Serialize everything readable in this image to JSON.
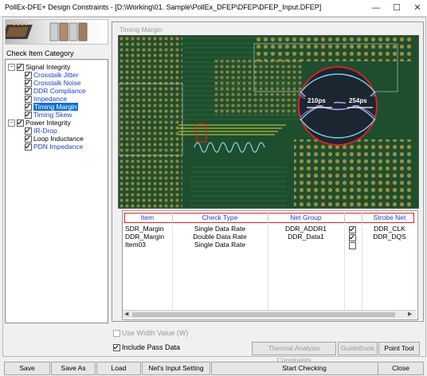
{
  "window": {
    "title": "PollEx-DFE+ Design Constraints - [D:\\Working\\01. Sample\\PollEx_DFEP\\DFEP\\DFEP_Input.DFEP]",
    "min": "—",
    "max": "☐",
    "close": "✕"
  },
  "sidebar": {
    "heading": "Check Item Category",
    "groups": [
      {
        "label": "Signal Integrity",
        "items": [
          "Crosstalk Jitter",
          "Crosstalk Noise",
          "DDR Compliance",
          "Impedance",
          "Timing Margin",
          "Timing Skew"
        ]
      },
      {
        "label": "Power Integrity",
        "items": [
          "IR-Drop",
          "Loop Inductance",
          "PDN Impedance"
        ]
      }
    ],
    "selected": "Timing Margin"
  },
  "panel": {
    "title": "Timing Margin",
    "eye_left": "210ps",
    "eye_right": "254ps"
  },
  "table": {
    "headers": [
      "Item",
      "Check Type",
      "Net Group",
      "",
      "Strobe Net"
    ],
    "rows": [
      {
        "item": "SDR_Margin",
        "check_type": "Single Data Rate",
        "net_group": "DDR_ADDR1",
        "checked": true,
        "strobe": "DDR_CLK"
      },
      {
        "item": "DDR_Margin",
        "check_type": "Double Data Rate",
        "net_group": "DDR_Data1",
        "checked": true,
        "strobe": "DDR_DQS"
      },
      {
        "item": "Item03",
        "check_type": "Single Data Rate",
        "net_group": "",
        "checked": false,
        "strobe": ""
      }
    ]
  },
  "options": {
    "use_width": "Use Width Value (W)",
    "include_pass": "Include Pass Data"
  },
  "tools": {
    "thermal": "Thermal Analysis Constraints",
    "guidebook": "GuideBook",
    "point_tool": "Point Tool"
  },
  "footer": {
    "save": "Save",
    "save_as": "Save As",
    "load": "Load",
    "nets_input": "Net's Input Setting",
    "start": "Start Checking",
    "close": "Close"
  }
}
